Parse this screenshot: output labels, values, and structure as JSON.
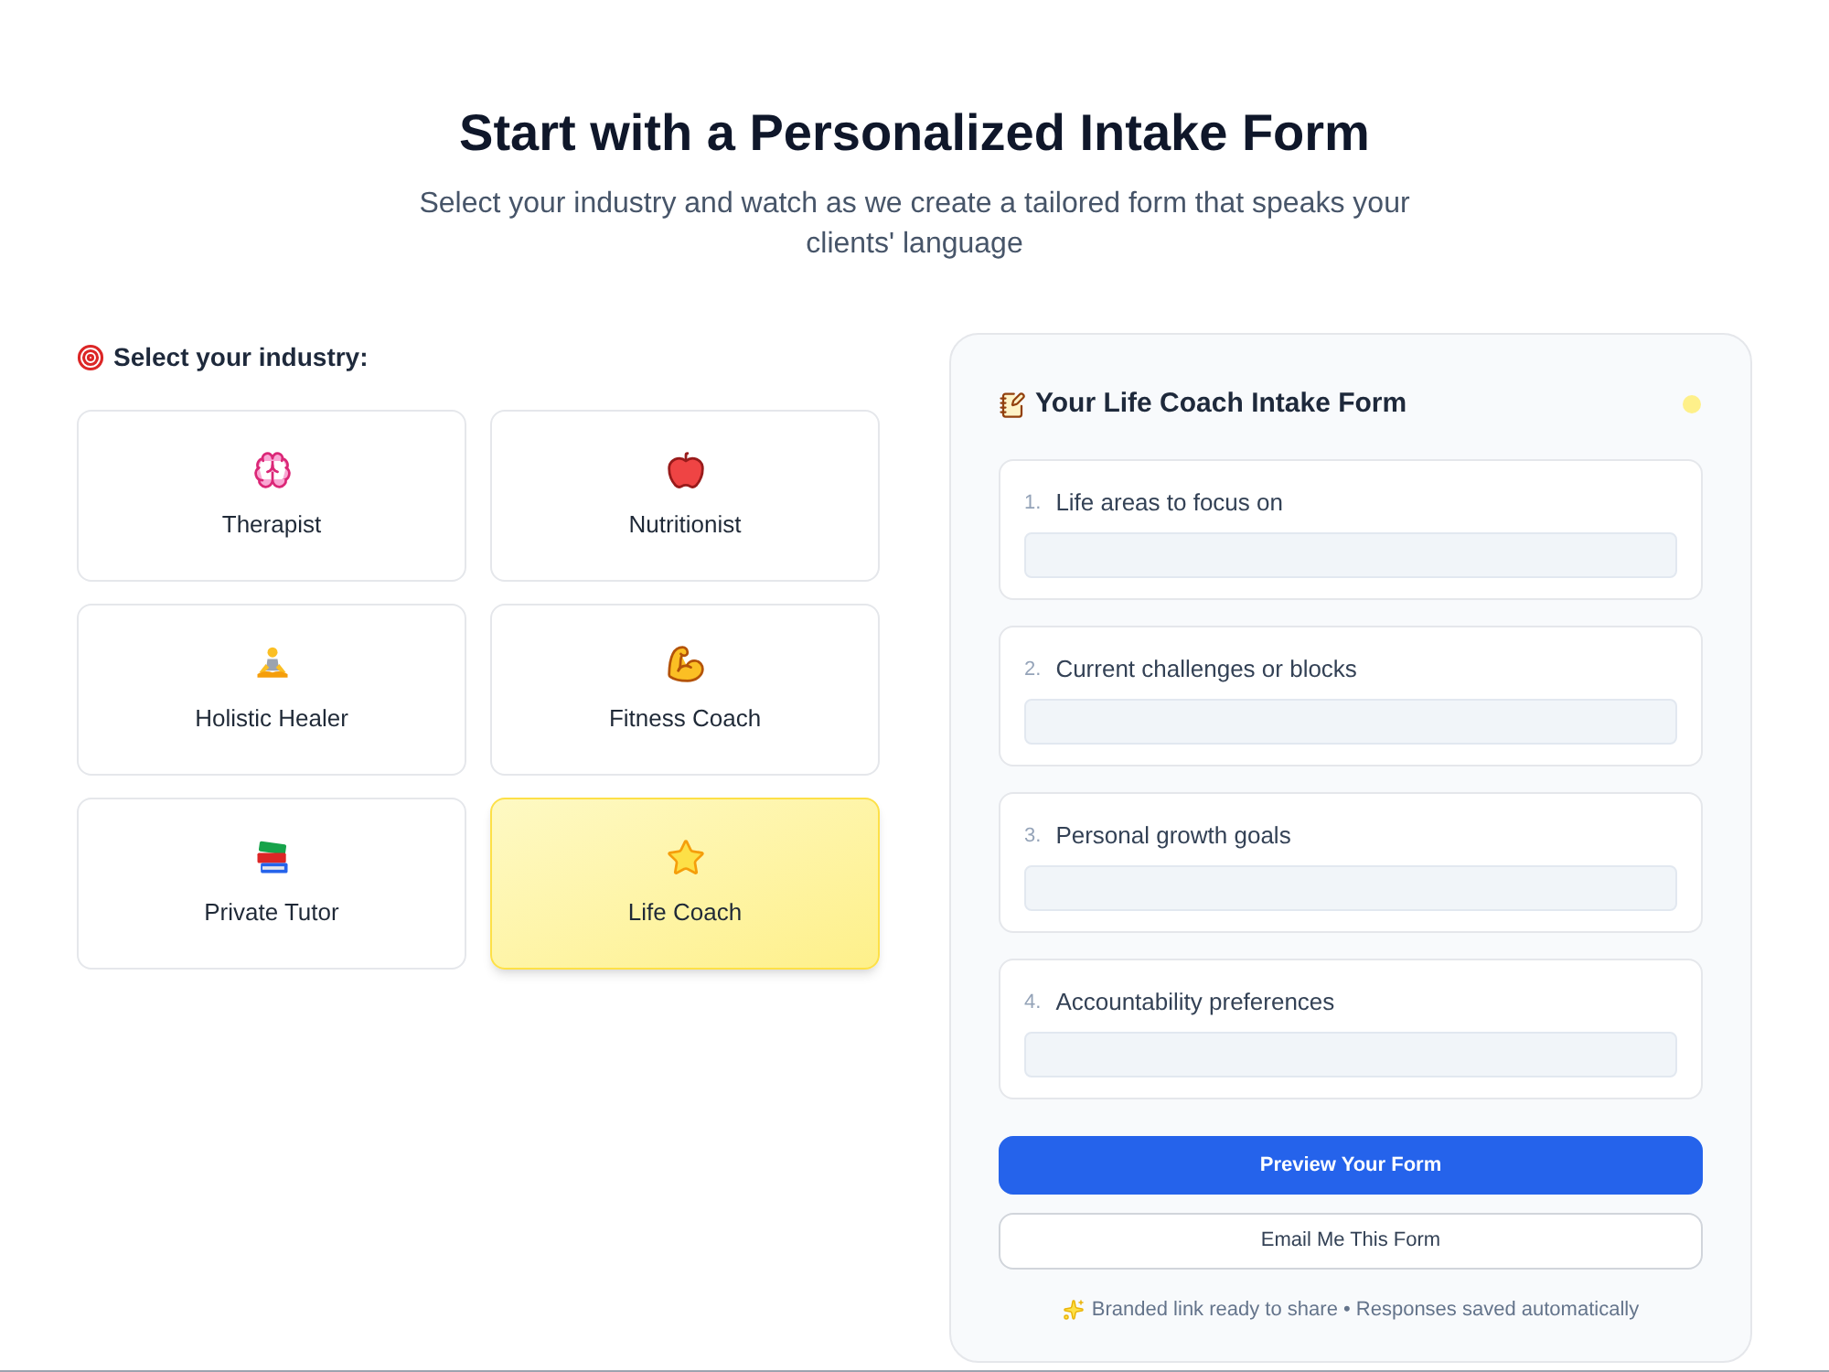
{
  "header": {
    "title": "Start with a Personalized Intake Form",
    "subtitle": "Select your industry and watch as we create a tailored form that speaks your clients' language"
  },
  "industry_picker": {
    "label": "Select your industry:",
    "industries": [
      {
        "label": "Therapist",
        "selected": false
      },
      {
        "label": "Nutritionist",
        "selected": false
      },
      {
        "label": "Holistic Healer",
        "selected": false
      },
      {
        "label": "Fitness Coach",
        "selected": false
      },
      {
        "label": "Private Tutor",
        "selected": false
      },
      {
        "label": "Life Coach",
        "selected": true
      }
    ]
  },
  "form_preview": {
    "title": "Your Life Coach Intake Form",
    "questions": [
      {
        "number": "1.",
        "label": "Life areas to focus on"
      },
      {
        "number": "2.",
        "label": "Current challenges or blocks"
      },
      {
        "number": "3.",
        "label": "Personal growth goals"
      },
      {
        "number": "4.",
        "label": "Accountability preferences"
      }
    ],
    "buttons": [
      {
        "label": "Preview Your Form",
        "kind": "primary"
      },
      {
        "label": "Email Me This Form",
        "kind": "secondary"
      }
    ],
    "footer_note": "Branded link ready to share • Responses saved automatically"
  }
}
